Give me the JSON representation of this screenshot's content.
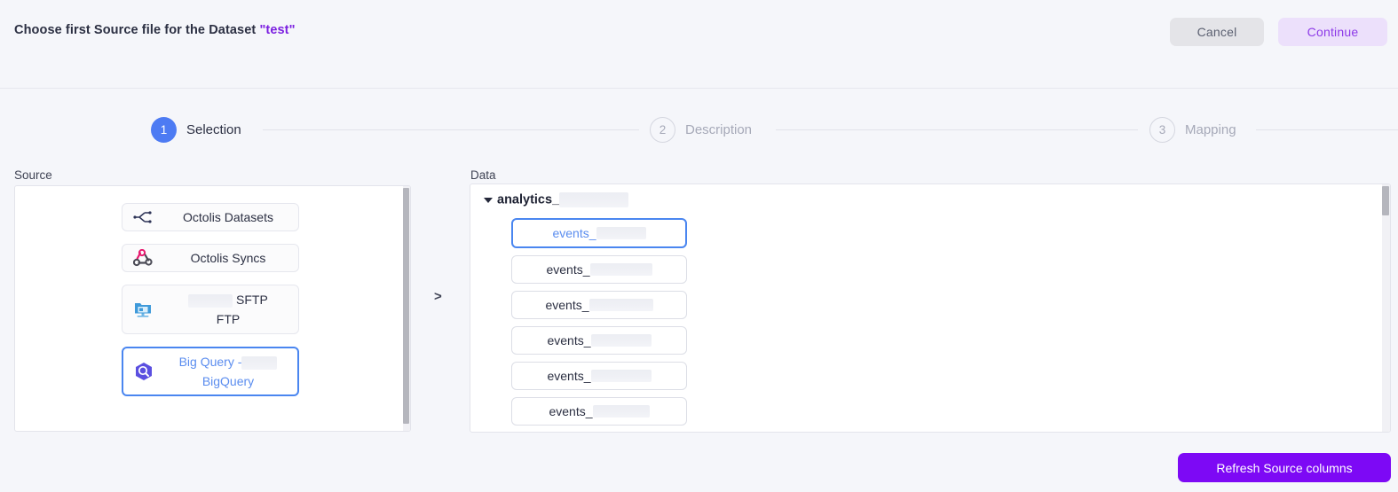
{
  "header": {
    "title_prefix": "Choose first Source file for the Dataset ",
    "dataset_name": "\"test\"",
    "cancel_label": "Cancel",
    "continue_label": "Continue"
  },
  "stepper": {
    "steps": [
      {
        "number": "1",
        "label": "Selection",
        "state": "active"
      },
      {
        "number": "2",
        "label": "Description",
        "state": "idle"
      },
      {
        "number": "3",
        "label": "Mapping",
        "state": "idle"
      }
    ]
  },
  "source": {
    "label": "Source",
    "items": [
      {
        "name": "Octolis Datasets",
        "icon": "branch-merge-icon",
        "selected": false,
        "redacted": false
      },
      {
        "name": "Octolis Syncs",
        "icon": "webhook-icon",
        "selected": false,
        "redacted": false
      },
      {
        "name_line1": "SFTP",
        "name_line2": "FTP",
        "icon": "sftp-folder-icon",
        "selected": false,
        "redacted": true
      },
      {
        "name_line1": "Big Query -",
        "name_line2": "BigQuery",
        "icon": "bigquery-icon",
        "selected": true,
        "redacted": true
      }
    ]
  },
  "arrow": {
    "glyph": ">"
  },
  "data": {
    "label": "Data",
    "tree_root": "analytics_",
    "items": [
      {
        "name": "events_",
        "selected": true
      },
      {
        "name": "events_",
        "selected": false
      },
      {
        "name": "events_",
        "selected": false
      },
      {
        "name": "events_",
        "selected": false
      },
      {
        "name": "events_",
        "selected": false
      },
      {
        "name": "events_",
        "selected": false
      }
    ]
  },
  "footer": {
    "refresh_label": "Refresh Source columns"
  },
  "colors": {
    "accent_purple": "#7d09f5",
    "accent_blue": "#4d7bf3",
    "continue_bg": "#ece0fb",
    "continue_text": "#8d3ae8",
    "page_bg": "#f5f6fa"
  }
}
